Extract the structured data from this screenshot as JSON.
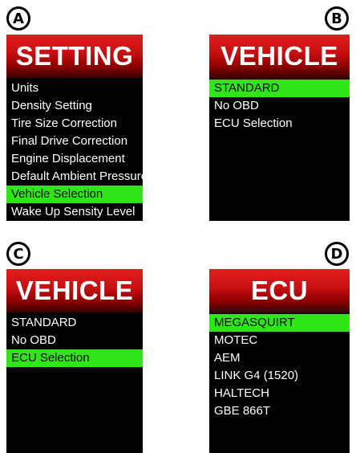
{
  "panels": [
    {
      "badge": "A",
      "title": "SETTING",
      "items": [
        "Units",
        "Density Setting",
        "Tire Size Correction",
        "Final Drive Correction",
        "Engine Displacement",
        "Default Ambient Pressure",
        "Vehicle Selection",
        "Wake Up Sensity Level"
      ],
      "selected_index": 6
    },
    {
      "badge": "B",
      "title": "VEHICLE",
      "items": [
        "STANDARD",
        "No OBD",
        "ECU Selection"
      ],
      "selected_index": 0
    },
    {
      "badge": "C",
      "title": "VEHICLE",
      "items": [
        "STANDARD",
        "No OBD",
        "ECU Selection"
      ],
      "selected_index": 2
    },
    {
      "badge": "D",
      "title": "ECU",
      "items": [
        "MEGASQUIRT",
        "MOTEC",
        "AEM",
        "LINK G4 (1520)",
        "HALTECH",
        "GBE 866T"
      ],
      "selected_index": 0
    }
  ],
  "colors": {
    "highlight": "#2fe61a",
    "header_red": "#c40f10",
    "screen_bg": "#000000"
  }
}
